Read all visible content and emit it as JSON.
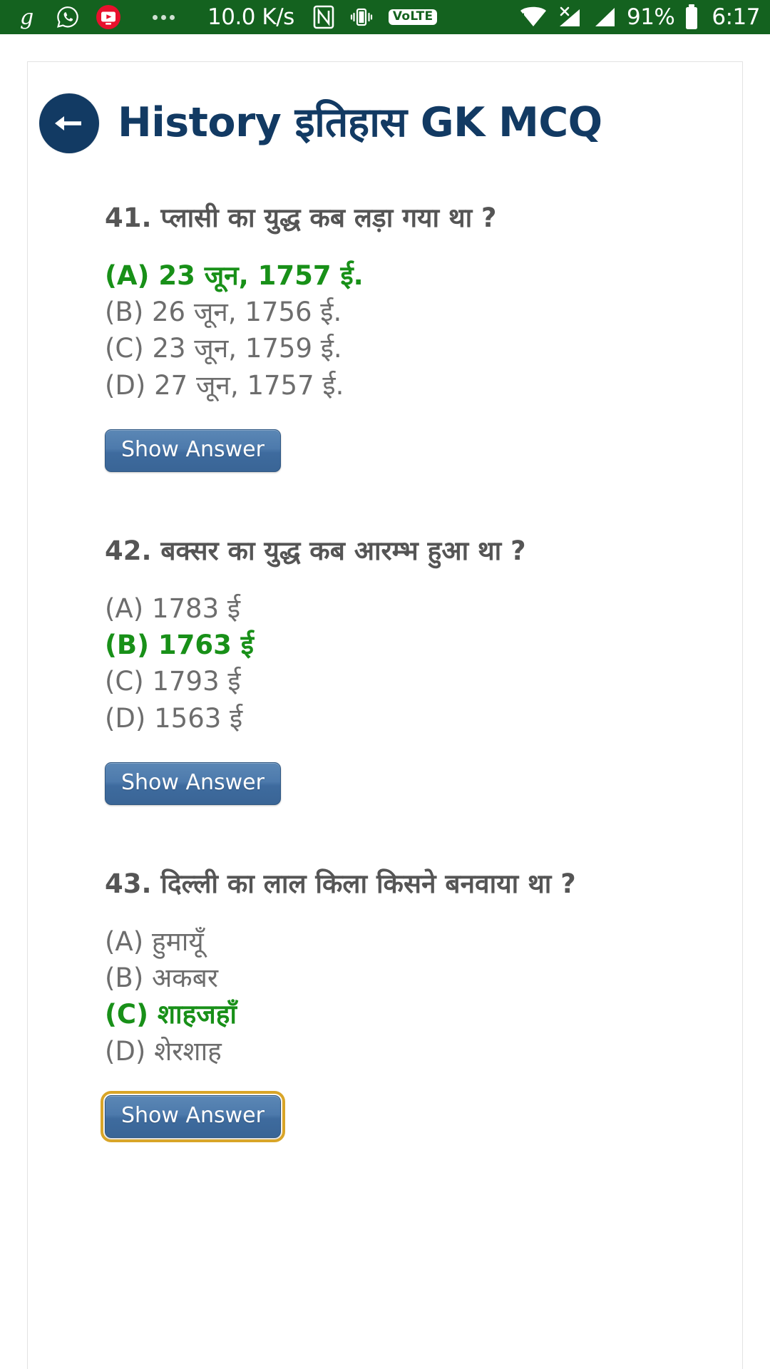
{
  "statusbar": {
    "background": "#14621f",
    "notification_icons": [
      "g-icon",
      "whatsapp-icon",
      "youtube-icon"
    ],
    "more_notifications": "more-dots-icon",
    "network_speed": "10.0 K/s",
    "nfc_icon": "nfc-icon",
    "vibrate_icon": "vibrate-icon",
    "volte_label": "VoLTE",
    "wifi_icon": "wifi-icon",
    "signal1_icon": "signal-no-data-icon",
    "signal2_icon": "signal-icon",
    "battery_percent": "91%",
    "battery_icon": "battery-icon",
    "clock": "6:17"
  },
  "header": {
    "back_icon": "back-arrow-icon",
    "title": "History इतिहास GK MCQ",
    "accent": "#123a63"
  },
  "colors": {
    "correct_green": "#189018",
    "question_gray": "#555555",
    "option_gray": "#6d6d6d",
    "button_blue": "#3e6b9e",
    "focus_gold": "#d9a528"
  },
  "questions": [
    {
      "number": "41.",
      "text": "41. प्लासी का युद्ध कब लड़ा गया था ?",
      "options": [
        {
          "label": "(A) 23 जून, 1757 ई.",
          "correct": true
        },
        {
          "label": "(B) 26 जून, 1756 ई.",
          "correct": false
        },
        {
          "label": "(C) 23 जून, 1759 ई.",
          "correct": false
        },
        {
          "label": "(D) 27 जून, 1757 ई.",
          "correct": false
        }
      ],
      "show_answer_label": "Show Answer",
      "focused": false
    },
    {
      "number": "42.",
      "text": "42. बक्सर का युद्ध कब आरम्भ हुआ था ?",
      "options": [
        {
          "label": "(A) 1783 ई",
          "correct": false
        },
        {
          "label": "(B) 1763 ई",
          "correct": true
        },
        {
          "label": "(C) 1793 ई",
          "correct": false
        },
        {
          "label": "(D) 1563 ई",
          "correct": false
        }
      ],
      "show_answer_label": "Show Answer",
      "focused": false
    },
    {
      "number": "43.",
      "text": "43. दिल्ली का लाल किला किसने बनवाया था ?",
      "options": [
        {
          "label": "(A) हुमायूँ",
          "correct": false
        },
        {
          "label": "(B) अकबर",
          "correct": false
        },
        {
          "label": "(C) शाहजहाँ",
          "correct": true
        },
        {
          "label": "(D) शेरशाह",
          "correct": false
        }
      ],
      "show_answer_label": "Show Answer",
      "focused": true
    }
  ]
}
